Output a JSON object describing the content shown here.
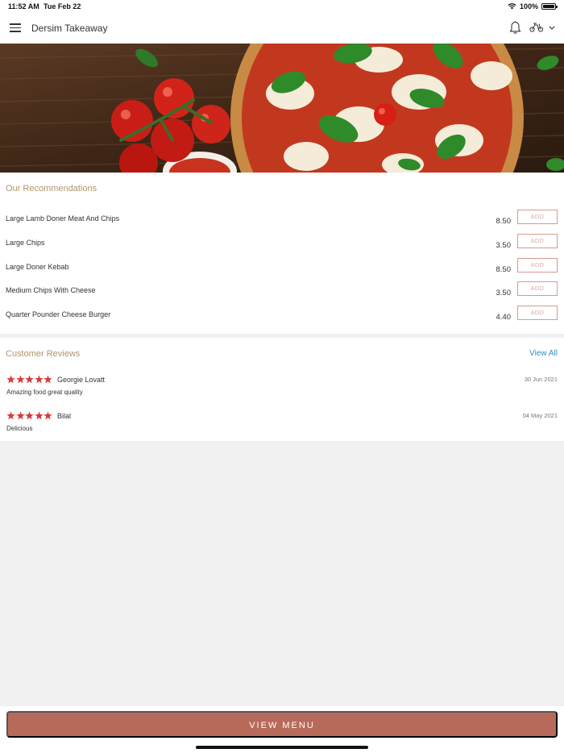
{
  "status_bar": {
    "time": "11:52 AM",
    "date": "Tue Feb 22",
    "battery": "100%"
  },
  "header": {
    "title": "Dersim Takeaway",
    "icons": [
      "menu-icon",
      "bell-icon",
      "scooter-icon",
      "chevron-down-icon"
    ]
  },
  "hero": {
    "description_icon": "pizza-hero-image"
  },
  "recommendations": {
    "title": "Our Recommendations",
    "add_label": "ADD",
    "items": [
      {
        "name": "Large Lamb Doner Meat And Chips",
        "price": "8.50"
      },
      {
        "name": "Large Chips",
        "price": "3.50"
      },
      {
        "name": "Large Doner Kebab",
        "price": "8.50"
      },
      {
        "name": "Medium Chips With Cheese",
        "price": "3.50"
      },
      {
        "name": "Quarter Pounder Cheese Burger",
        "price": "4.40"
      }
    ]
  },
  "reviews": {
    "title": "Customer Reviews",
    "view_all": "View All",
    "items": [
      {
        "reviewer": "Georgie Lovatt",
        "date": "30 Jun 2021",
        "comment": "Amazing food great quality",
        "rating": 5
      },
      {
        "reviewer": "Bilal",
        "date": "04 May 2021",
        "comment": "Delicious",
        "rating": 5
      }
    ]
  },
  "footer": {
    "button_label": "VIEW MENU"
  },
  "colors": {
    "accent": "#b86a5a",
    "section_title": "#b0946a",
    "link": "#2e8fc4",
    "star": "#d83a3a"
  }
}
